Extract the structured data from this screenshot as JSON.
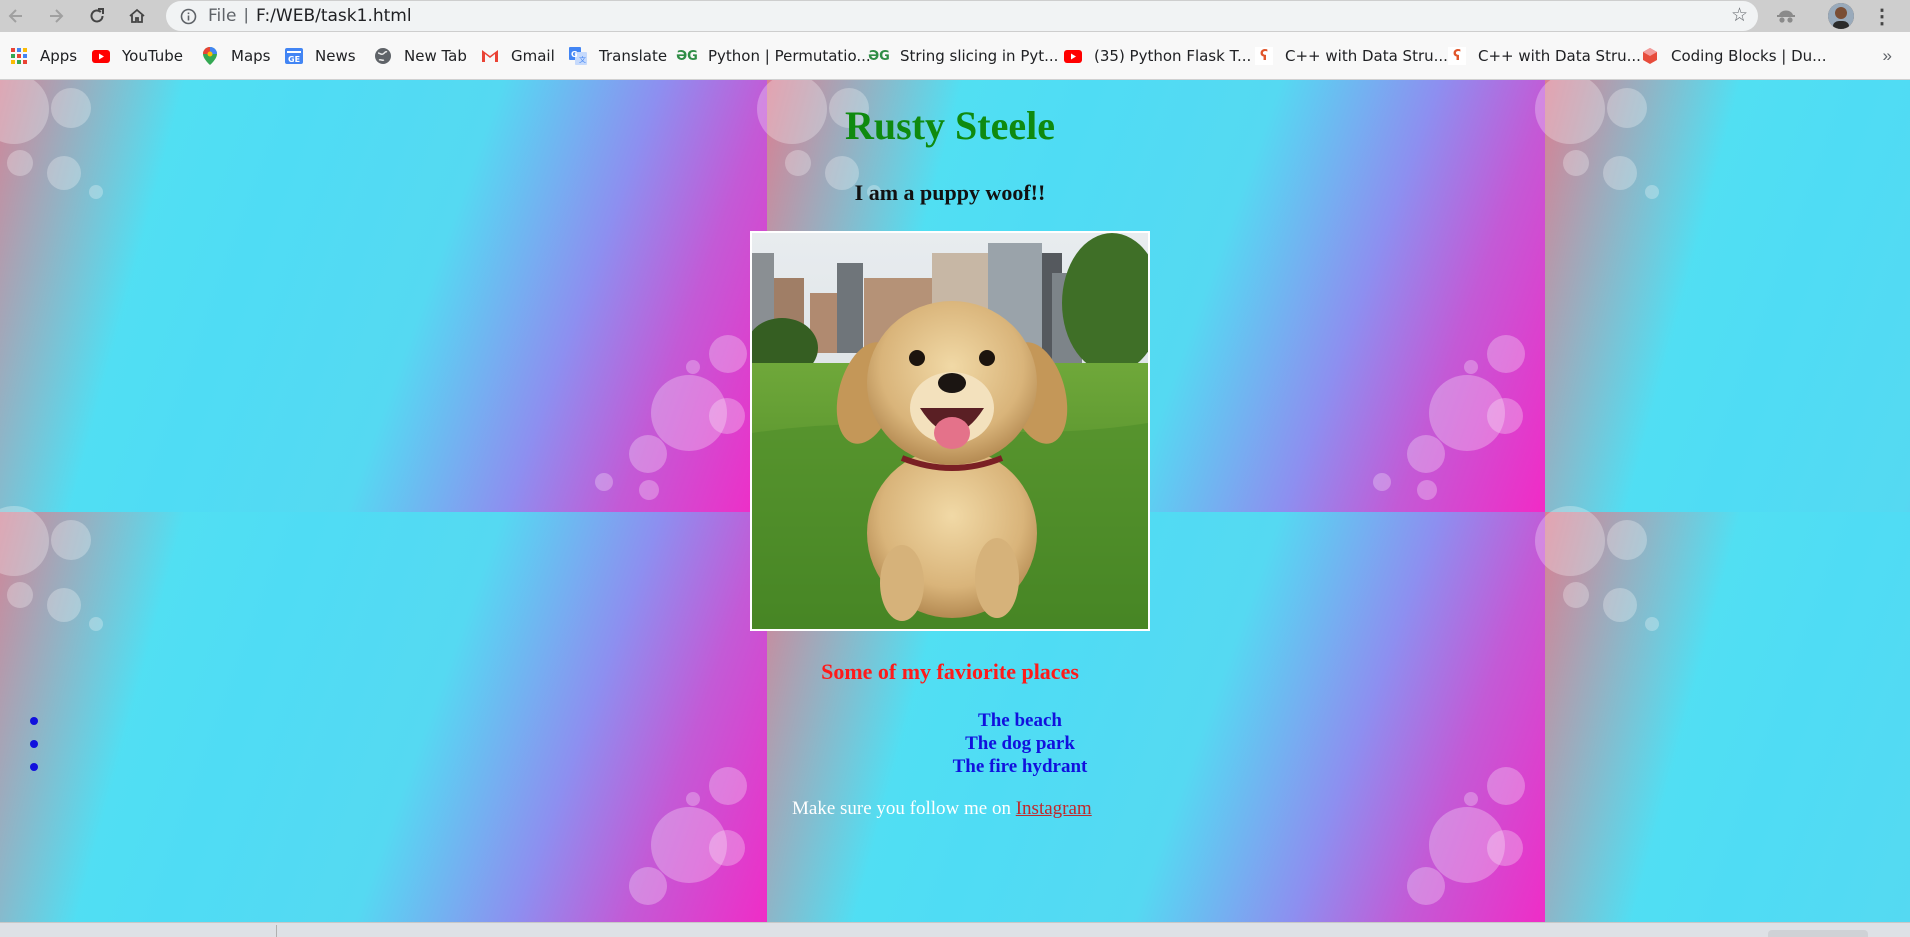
{
  "browser": {
    "scheme_label": "File",
    "separator": "|",
    "url": "F:/WEB/task1.html",
    "more_menu": "⋮"
  },
  "bookmarks": {
    "items": [
      {
        "label": "Apps",
        "icon": "apps-grid-icon"
      },
      {
        "label": "YouTube",
        "icon": "youtube-icon"
      },
      {
        "label": "Maps",
        "icon": "maps-icon"
      },
      {
        "label": "News",
        "icon": "news-icon"
      },
      {
        "label": "New Tab",
        "icon": "globe-icon"
      },
      {
        "label": "Gmail",
        "icon": "gmail-icon"
      },
      {
        "label": "Translate",
        "icon": "translate-icon"
      },
      {
        "label": "Python | Permutatio...",
        "icon": "geeksforgeeks-icon"
      },
      {
        "label": "String slicing in Pyt...",
        "icon": "geeksforgeeks-icon"
      },
      {
        "label": "(35) Python Flask T...",
        "icon": "youtube-icon"
      },
      {
        "label": "C++ with Data Stru...",
        "icon": "coding-ninjas-icon"
      },
      {
        "label": "C++ with Data Stru...",
        "icon": "coding-ninjas-icon"
      },
      {
        "label": "Coding Blocks | Du...",
        "icon": "coding-blocks-icon"
      }
    ],
    "overflow": "»"
  },
  "page": {
    "title": "Rusty Steele",
    "subtitle": "I am a puppy woof!!",
    "image_alt": "Golden retriever puppy running on grass in a city park",
    "places_heading": "Some of my faviorite places",
    "places": [
      "The beach",
      "The dog park",
      "The fire hydrant"
    ],
    "follow_text": "Make sure you follow me on ",
    "follow_link": "Instagram"
  },
  "colors": {
    "title": "#0f8a0f",
    "places_heading": "#ff1a1a",
    "places": "#1111dd",
    "link": "#c0282b",
    "background_cyan": "#4fdfef",
    "background_magenta": "#f22ac6"
  }
}
